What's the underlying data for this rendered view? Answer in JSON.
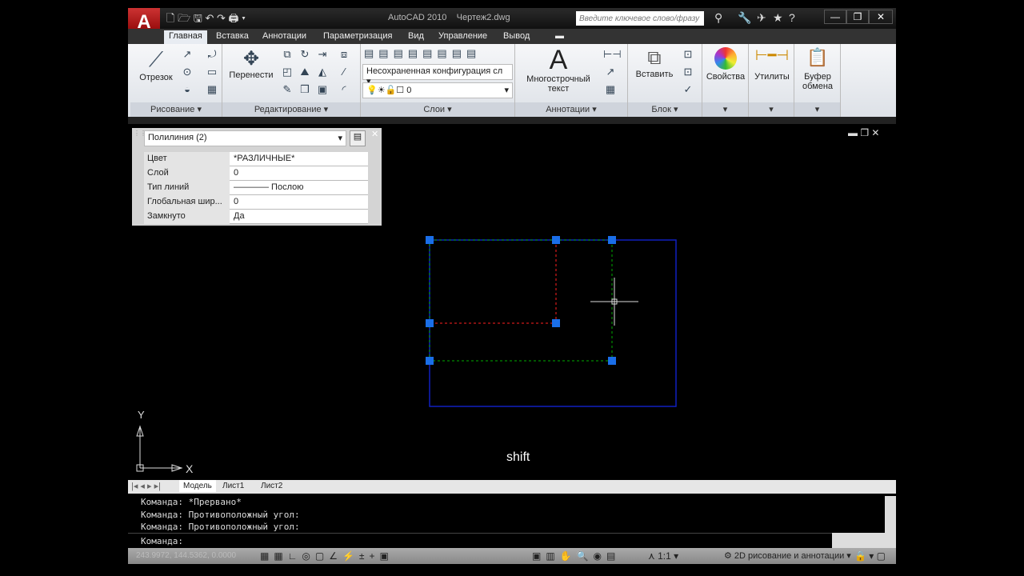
{
  "title": {
    "app": "AutoCAD 2010",
    "file": "Чертеж2.dwg",
    "search_placeholder": "Введите ключевое слово/фразу"
  },
  "tabs": [
    "Главная",
    "Вставка",
    "Аннотации",
    "Параметризация",
    "Вид",
    "Управление",
    "Вывод"
  ],
  "ribbon": {
    "draw": {
      "label": "Рисование",
      "line": "Отрезок"
    },
    "modify": {
      "label": "Редактирование",
      "move": "Перенести"
    },
    "layers": {
      "label": "Слои",
      "state": "Несохраненная конфигурация сл",
      "layer": "0"
    },
    "annotation": {
      "label": "Аннотации",
      "mtext": "Многострочный текст"
    },
    "block": {
      "label": "Блок",
      "insert": "Вставить"
    },
    "properties": {
      "label": "Свойства"
    },
    "utilities": {
      "label": "Утилиты"
    },
    "clipboard": {
      "label": "Буфер обмена"
    }
  },
  "properties_palette": {
    "selection": "Полилиния (2)",
    "rows": [
      {
        "key": "Цвет",
        "value": "*РАЗЛИЧНЫЕ*"
      },
      {
        "key": "Слой",
        "value": "0"
      },
      {
        "key": "Тип линий",
        "value": "———— Послою"
      },
      {
        "key": "Глобальная шир...",
        "value": "0"
      },
      {
        "key": "Замкнуто",
        "value": "Да"
      }
    ]
  },
  "canvas": {
    "overlay_text": "shift",
    "ucs_x": "X",
    "ucs_y": "Y",
    "colors": {
      "selection": "#00aa00",
      "red": "#ff2020",
      "blue": "#1020c0",
      "grip": "#1a6ee8"
    }
  },
  "layout_tabs": [
    "Модель",
    "Лист1",
    "Лист2"
  ],
  "command": {
    "history": [
      "Команда: *Прервано*",
      "Команда: Противоположный угол:",
      "Команда: Противоположный угол:"
    ],
    "prompt": "Команда:"
  },
  "status": {
    "coords": "243.9972, 144.5362, 0.0000",
    "scale": "1:1",
    "workspace": "2D рисование и аннотации"
  }
}
